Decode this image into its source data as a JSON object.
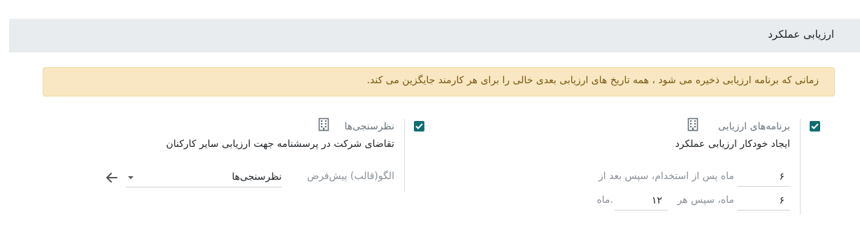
{
  "section": {
    "title": "ارزیابی عملکرد"
  },
  "alert": {
    "text": "زمانی که برنامه ارزیابی ذخیره می شود ، همه تاریخ های ارزیابی بعدی خالی را برای هر کارمند جایگزین می کند."
  },
  "appraisal_plans": {
    "checked": true,
    "title": "برنامه‌های ارزیابی",
    "description": "ایجاد خودکار ارزیابی عملکرد",
    "row1_value": "۶",
    "row1_label": "ماه پس از استخدام، سپس بعد از",
    "row2_value": "۶",
    "row2_label_a": "ماه، سپس هر",
    "row2_value_b": "۱۲",
    "row2_label_b": "ماه.",
    "icon": "building-icon"
  },
  "surveys": {
    "checked": true,
    "title": "نظرسنجی‌ها",
    "description": "تقاضای شرکت در پرسشنامه جهت ارزیابی سایر کارکنان",
    "template_label": "الگو(قالب) پیش‌فرض",
    "template_value": "نظرسنجی‌ها",
    "icon": "building-icon",
    "link_icon": "arrow-right-icon"
  },
  "colors": {
    "checkbox": "#0f6e72",
    "alert_bg": "#f8e7c2",
    "alert_text": "#7a5713",
    "header_bg": "#e9ecef"
  }
}
